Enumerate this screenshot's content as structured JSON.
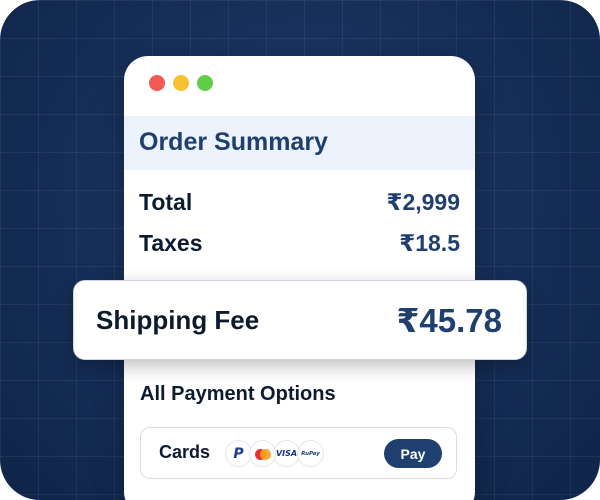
{
  "window_controls": {
    "colors": {
      "close": "#f05a52",
      "minimize": "#f5c332",
      "maximize": "#5fcf4a"
    }
  },
  "order_summary": {
    "title": "Order Summary",
    "rows": [
      {
        "label": "Total",
        "value": "₹2,999"
      },
      {
        "label": "Taxes",
        "value": "₹18.5"
      }
    ],
    "shipping": {
      "label": "Shipping Fee",
      "value": "₹45.78"
    }
  },
  "payment": {
    "heading": "All Payment Options",
    "method_label": "Cards",
    "logos": [
      {
        "name": "paypal-icon",
        "glyph": "P"
      },
      {
        "name": "mastercard-icon",
        "glyph": ""
      },
      {
        "name": "visa-icon",
        "glyph": "VISA"
      },
      {
        "name": "rupay-icon",
        "glyph": "RuPay"
      }
    ],
    "pay_button": "Pay"
  },
  "colors": {
    "brand": "#1f3f6e",
    "background": "#17305a",
    "title_band": "#ecf3fc"
  }
}
